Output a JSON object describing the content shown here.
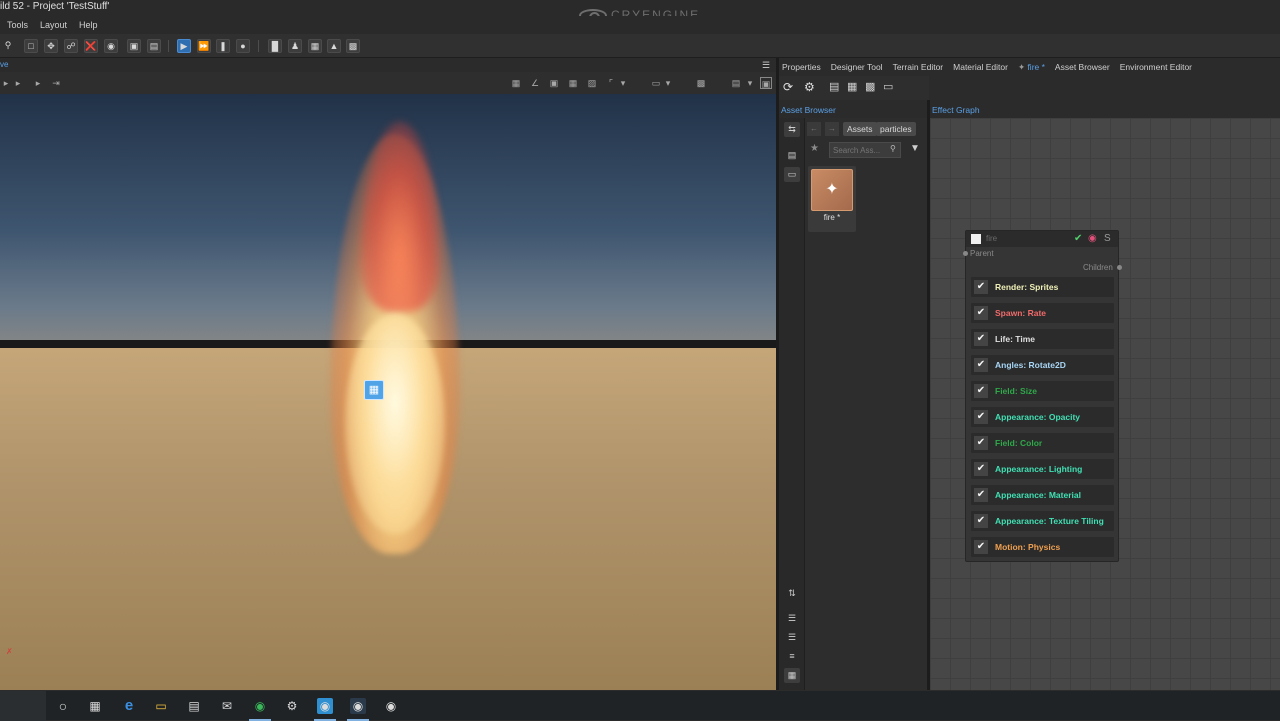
{
  "window": {
    "title": "ild 52 - Project 'TestStuff'",
    "brand": "CRYENGINE"
  },
  "menu": [
    "Tools",
    "Layout",
    "Help"
  ],
  "viewport": {
    "tab_label": "ve"
  },
  "right_tabs": [
    {
      "label": "Properties",
      "active": false
    },
    {
      "label": "Designer Tool",
      "active": false
    },
    {
      "label": "Terrain Editor",
      "active": false
    },
    {
      "label": "Material Editor",
      "active": false
    },
    {
      "label": "fire *",
      "active": true
    },
    {
      "label": "Asset Browser",
      "active": false
    },
    {
      "label": "Environment Editor",
      "active": false
    }
  ],
  "asset_browser": {
    "title": "Asset Browser",
    "breadcrumbs": [
      "Assets",
      "particles"
    ],
    "search_placeholder": "Search Ass...",
    "asset": {
      "label": "fire *",
      "icon": "sparkles-icon"
    }
  },
  "effect_graph": {
    "title": "Effect Graph",
    "node": {
      "title": "fire",
      "parent_label": "Parent",
      "children_label": "Children",
      "s_label": "S",
      "features": [
        {
          "label": "Render: Sprites",
          "color": "#f0f0b8",
          "checked": true
        },
        {
          "label": "Spawn: Rate",
          "color": "#f06a6a",
          "checked": true
        },
        {
          "label": "Life: Time",
          "color": "#e0e0e0",
          "checked": true
        },
        {
          "label": "Angles: Rotate2D",
          "color": "#a8d6f6",
          "checked": true
        },
        {
          "label": "Field: Size",
          "color": "#2fa84a",
          "checked": true
        },
        {
          "label": "Appearance: Opacity",
          "color": "#40e0b4",
          "checked": true
        },
        {
          "label": "Field: Color",
          "color": "#2fa84a",
          "checked": true
        },
        {
          "label": "Appearance: Lighting",
          "color": "#40e0b4",
          "checked": true
        },
        {
          "label": "Appearance: Material",
          "color": "#40e0b4",
          "checked": true
        },
        {
          "label": "Appearance: Texture Tiling",
          "color": "#40e0b4",
          "checked": true
        },
        {
          "label": "Motion: Physics",
          "color": "#f0a050",
          "checked": true
        }
      ]
    }
  },
  "taskbar": {
    "icons": [
      "cortana-icon",
      "task-view-icon",
      "edge-icon",
      "file-explorer-icon",
      "store-icon",
      "mail-icon",
      "chrome-icon",
      "steam-icon",
      "cryengine-launcher-icon",
      "cryengine-sandbox-icon",
      "obs-icon"
    ]
  }
}
